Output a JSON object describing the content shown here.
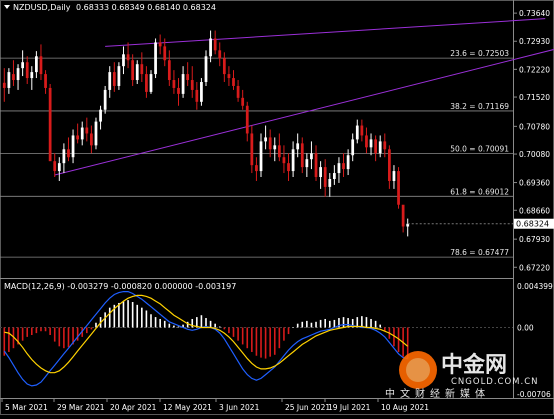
{
  "header": {
    "symbol": "NZDUSD,Daily",
    "ohlc": "0.68333 0.68349 0.68140 0.68324",
    "macd_label": "MACD(12,26,9) -0.003279 -0.000820 0.000000 -0.003197",
    "dropdown_icon": "triangle-down-icon"
  },
  "colors": {
    "background": "#000000",
    "bull_candle": "#ffffff",
    "bear_candle": "#d81b1b",
    "trend_line": "#9b30d9",
    "fib_line": "#8a8a8a",
    "grid": "#3a3a3a",
    "macd_line": "#1f5fff",
    "signal_line": "#ffd200",
    "histogram_pos": "#ffffff",
    "histogram_neg": "#d81b1b",
    "price_tag_bg": "#ffffff",
    "watermark": "#ff6a00"
  },
  "watermark": {
    "cn": "中金网",
    "en": "CNGOLD.COM.CN",
    "sub": "中文财经新媒体"
  },
  "chart_data": [
    {
      "type": "candlestick",
      "symbol": "NZDUSD",
      "timeframe": "Daily",
      "y_ticks": [
        "0.73640",
        "0.72930",
        "0.72220",
        "0.71520",
        "0.70780",
        "0.70080",
        "0.69360",
        "0.68660",
        "0.67930",
        "0.67220"
      ],
      "ylim": [
        0.6705,
        0.7382
      ],
      "x_ticks": [
        "5 Mar 2021",
        "29 Mar 2021",
        "20 Apr 2021",
        "12 May 2021",
        "3 Jun 2021",
        "25 Jun 2021",
        "19 Jul 2021",
        "10 Aug 2021"
      ],
      "last_price_tag": "0.68324",
      "fib_levels": [
        {
          "label": "23.6 = 0.72503",
          "value": 0.72503
        },
        {
          "label": "38.2 = 0.71169",
          "value": 0.71169
        },
        {
          "label": "50.0 = 0.70091",
          "value": 0.70091
        },
        {
          "label": "61.8 = 0.69012",
          "value": 0.69012
        },
        {
          "label": "78.6 = 0.67477",
          "value": 0.67477
        }
      ],
      "trend_lines": [
        {
          "from": [
            22,
            0.728
          ],
          "to": [
            118,
            0.735
          ]
        },
        {
          "from": [
            11,
            0.6955
          ],
          "to": [
            126,
            0.729
          ]
        }
      ],
      "candles": [
        [
          0.7188,
          0.7225,
          0.714,
          0.7175
        ],
        [
          0.7175,
          0.7225,
          0.716,
          0.7215
        ],
        [
          0.721,
          0.7245,
          0.718,
          0.7195
        ],
        [
          0.7195,
          0.7235,
          0.717,
          0.7225
        ],
        [
          0.7225,
          0.727,
          0.7205,
          0.724
        ],
        [
          0.724,
          0.7255,
          0.7185,
          0.72
        ],
        [
          0.72,
          0.723,
          0.717,
          0.7215
        ],
        [
          0.7215,
          0.7268,
          0.72,
          0.7255
        ],
        [
          0.7255,
          0.7285,
          0.7195,
          0.721
        ],
        [
          0.721,
          0.722,
          0.716,
          0.7175
        ],
        [
          0.7175,
          0.7185,
          0.708,
          0.699
        ],
        [
          0.699,
          0.701,
          0.695,
          0.6965
        ],
        [
          0.6965,
          0.7,
          0.694,
          0.6985
        ],
        [
          0.6985,
          0.7035,
          0.696,
          0.702
        ],
        [
          0.702,
          0.705,
          0.699,
          0.7
        ],
        [
          0.7,
          0.707,
          0.6985,
          0.7055
        ],
        [
          0.7055,
          0.7085,
          0.7035,
          0.7045
        ],
        [
          0.7045,
          0.709,
          0.703,
          0.7075
        ],
        [
          0.7075,
          0.71,
          0.704,
          0.706
        ],
        [
          0.706,
          0.708,
          0.701,
          0.703
        ],
        [
          0.703,
          0.71,
          0.702,
          0.709
        ],
        [
          0.709,
          0.713,
          0.707,
          0.712
        ],
        [
          0.712,
          0.718,
          0.711,
          0.717
        ],
        [
          0.717,
          0.723,
          0.715,
          0.7215
        ],
        [
          0.7215,
          0.724,
          0.7165,
          0.718
        ],
        [
          0.718,
          0.724,
          0.717,
          0.723
        ],
        [
          0.723,
          0.728,
          0.721,
          0.726
        ],
        [
          0.726,
          0.729,
          0.7225,
          0.7245
        ],
        [
          0.7245,
          0.726,
          0.718,
          0.7195
        ],
        [
          0.7195,
          0.7245,
          0.7185,
          0.7235
        ],
        [
          0.7235,
          0.7265,
          0.719,
          0.721
        ],
        [
          0.721,
          0.723,
          0.715,
          0.7165
        ],
        [
          0.7165,
          0.722,
          0.716,
          0.721
        ],
        [
          0.721,
          0.73,
          0.72,
          0.729
        ],
        [
          0.729,
          0.731,
          0.726,
          0.728
        ],
        [
          0.728,
          0.73,
          0.723,
          0.7245
        ],
        [
          0.7245,
          0.727,
          0.718,
          0.7195
        ],
        [
          0.7195,
          0.722,
          0.716,
          0.7175
        ],
        [
          0.7175,
          0.72,
          0.713,
          0.716
        ],
        [
          0.716,
          0.723,
          0.715,
          0.721
        ],
        [
          0.721,
          0.724,
          0.718,
          0.7195
        ],
        [
          0.7195,
          0.723,
          0.715,
          0.717
        ],
        [
          0.717,
          0.719,
          0.712,
          0.714
        ],
        [
          0.714,
          0.72,
          0.713,
          0.719
        ],
        [
          0.719,
          0.727,
          0.718,
          0.7255
        ],
        [
          0.7255,
          0.732,
          0.724,
          0.73
        ],
        [
          0.73,
          0.732,
          0.726,
          0.727
        ],
        [
          0.727,
          0.729,
          0.723,
          0.725
        ],
        [
          0.725,
          0.7265,
          0.719,
          0.721
        ],
        [
          0.721,
          0.723,
          0.718,
          0.72
        ],
        [
          0.72,
          0.722,
          0.717,
          0.718
        ],
        [
          0.718,
          0.7195,
          0.714,
          0.715
        ],
        [
          0.715,
          0.717,
          0.712,
          0.713
        ],
        [
          0.713,
          0.714,
          0.704,
          0.706
        ],
        [
          0.706,
          0.708,
          0.696,
          0.698
        ],
        [
          0.698,
          0.7,
          0.694,
          0.6965
        ],
        [
          0.6965,
          0.706,
          0.695,
          0.704
        ],
        [
          0.704,
          0.708,
          0.702,
          0.705
        ],
        [
          0.705,
          0.707,
          0.7,
          0.702
        ],
        [
          0.702,
          0.705,
          0.699,
          0.703
        ],
        [
          0.703,
          0.706,
          0.699,
          0.7
        ],
        [
          0.7,
          0.703,
          0.696,
          0.6985
        ],
        [
          0.6985,
          0.701,
          0.694,
          0.6965
        ],
        [
          0.6965,
          0.704,
          0.695,
          0.702
        ],
        [
          0.702,
          0.706,
          0.7,
          0.7035
        ],
        [
          0.7035,
          0.705,
          0.696,
          0.6975
        ],
        [
          0.6975,
          0.701,
          0.695,
          0.6995
        ],
        [
          0.6995,
          0.704,
          0.697,
          0.701
        ],
        [
          0.701,
          0.703,
          0.694,
          0.695
        ],
        [
          0.695,
          0.699,
          0.692,
          0.6975
        ],
        [
          0.6975,
          0.6995,
          0.69,
          0.6925
        ],
        [
          0.6925,
          0.696,
          0.69,
          0.6945
        ],
        [
          0.6945,
          0.698,
          0.693,
          0.696
        ],
        [
          0.696,
          0.7,
          0.6935,
          0.6985
        ],
        [
          0.6985,
          0.701,
          0.695,
          0.697
        ],
        [
          0.697,
          0.702,
          0.6955,
          0.7005
        ],
        [
          0.7005,
          0.706,
          0.699,
          0.7045
        ],
        [
          0.7045,
          0.7095,
          0.7035,
          0.708
        ],
        [
          0.708,
          0.7095,
          0.704,
          0.7055
        ],
        [
          0.7055,
          0.7075,
          0.701,
          0.7025
        ],
        [
          0.7025,
          0.706,
          0.7005,
          0.7045
        ],
        [
          0.7045,
          0.7055,
          0.699,
          0.701
        ],
        [
          0.701,
          0.7055,
          0.7,
          0.704
        ],
        [
          0.704,
          0.706,
          0.7,
          0.702
        ],
        [
          0.702,
          0.703,
          0.692,
          0.694
        ],
        [
          0.694,
          0.698,
          0.692,
          0.6965
        ],
        [
          0.6965,
          0.6975,
          0.687,
          0.688
        ],
        [
          0.688,
          0.686,
          0.681,
          0.6825
        ],
        [
          0.6825,
          0.6845,
          0.68,
          0.6832
        ]
      ]
    },
    {
      "type": "macd",
      "parameters": "12,26,9",
      "y_ticks": [
        "0.004399",
        "0.00",
        "-0.00706"
      ],
      "ylim": [
        -0.00706,
        0.004399
      ],
      "histogram": [
        -0.003,
        -0.0026,
        -0.0022,
        -0.0018,
        -0.0014,
        -0.001,
        -0.0008,
        -0.0006,
        -0.0004,
        -0.0004,
        -0.0008,
        -0.0015,
        -0.002,
        -0.0022,
        -0.0021,
        -0.0018,
        -0.0014,
        -0.001,
        -0.0006,
        -0.0002,
        0.0005,
        0.0011,
        0.0016,
        0.0021,
        0.0024,
        0.0026,
        0.0028,
        0.0029,
        0.0027,
        0.0024,
        0.0021,
        0.0018,
        0.0014,
        0.0011,
        0.0009,
        0.0007,
        0.0004,
        0.0002,
        0.0001,
        0.0003,
        0.0006,
        0.0009,
        0.0011,
        0.0013,
        0.001,
        0.0007,
        0.0004,
        0.0001,
        -0.0002,
        -0.0006,
        -0.001,
        -0.0014,
        -0.0018,
        -0.0022,
        -0.0026,
        -0.003,
        -0.0032,
        -0.0033,
        -0.0031,
        -0.0029,
        -0.0022,
        -0.0014,
        -0.0007,
        0.0,
        0.0004,
        0.0006,
        0.0007,
        0.0005,
        0.0006,
        0.0008,
        0.0009,
        0.0007,
        0.0008,
        0.001,
        0.0011,
        0.001,
        0.0009,
        0.0011,
        0.0012,
        0.0011,
        0.0009,
        0.0007,
        0.0003,
        -0.0004,
        -0.0012,
        -0.002,
        -0.0026,
        -0.0031,
        -0.0033
      ],
      "macd": [
        -0.0025,
        -0.0032,
        -0.004,
        -0.0048,
        -0.0055,
        -0.006,
        -0.0062,
        -0.0061,
        -0.0058,
        -0.0052,
        -0.0046,
        -0.004,
        -0.0034,
        -0.0028,
        -0.0022,
        -0.0016,
        -0.001,
        -0.0004,
        0.0002,
        0.0008,
        0.0014,
        0.002,
        0.0026,
        0.0031,
        0.0035,
        0.0037,
        0.0038,
        0.0038,
        0.0036,
        0.0033,
        0.003,
        0.0026,
        0.0022,
        0.0018,
        0.0014,
        0.001,
        0.0006,
        0.0004,
        0.0002,
        0.0,
        -0.0002,
        -0.0003,
        -0.0002,
        0.0,
        0.0001,
        0.0,
        -0.0002,
        -0.0006,
        -0.0012,
        -0.002,
        -0.0028,
        -0.0036,
        -0.0044,
        -0.005,
        -0.0054,
        -0.0056,
        -0.0054,
        -0.005,
        -0.0046,
        -0.0042,
        -0.0036,
        -0.003,
        -0.0024,
        -0.0019,
        -0.0015,
        -0.0012,
        -0.001,
        -0.0008,
        -0.0006,
        -0.0004,
        -0.0003,
        -0.0002,
        0.0,
        0.0002,
        0.0003,
        0.0003,
        0.0002,
        0.0001,
        0.0,
        0.0,
        -0.0001,
        -0.0003,
        -0.0006,
        -0.001,
        -0.0016,
        -0.0022,
        -0.0028,
        -0.0032,
        -0.0033
      ],
      "signal": [
        -0.0005,
        -0.0006,
        -0.001,
        -0.0015,
        -0.0021,
        -0.0028,
        -0.0034,
        -0.0039,
        -0.0043,
        -0.0046,
        -0.0048,
        -0.0048,
        -0.0046,
        -0.0042,
        -0.0037,
        -0.0031,
        -0.0025,
        -0.0019,
        -0.0013,
        -0.0007,
        -0.0001,
        0.0005,
        0.001,
        0.0015,
        0.002,
        0.0024,
        0.0028,
        0.0031,
        0.0033,
        0.0034,
        0.0034,
        0.0033,
        0.0031,
        0.0028,
        0.0025,
        0.0021,
        0.0017,
        0.0013,
        0.001,
        0.0007,
        0.0004,
        0.0002,
        0.0001,
        0.0,
        0.0,
        0.0,
        -0.0001,
        -0.0003,
        -0.0006,
        -0.001,
        -0.0015,
        -0.0021,
        -0.0027,
        -0.0033,
        -0.0038,
        -0.0042,
        -0.0044,
        -0.0044,
        -0.0043,
        -0.0041,
        -0.0038,
        -0.0034,
        -0.003,
        -0.0026,
        -0.0022,
        -0.0018,
        -0.0015,
        -0.0012,
        -0.0009,
        -0.0007,
        -0.0005,
        -0.0003,
        -0.0002,
        -0.0001,
        0.0,
        0.0001,
        0.0001,
        0.0001,
        0.0001,
        0.0,
        0.0,
        -0.0001,
        -0.0002,
        -0.0004,
        -0.0006,
        -0.0009,
        -0.0012,
        -0.0016,
        -0.002
      ]
    }
  ]
}
